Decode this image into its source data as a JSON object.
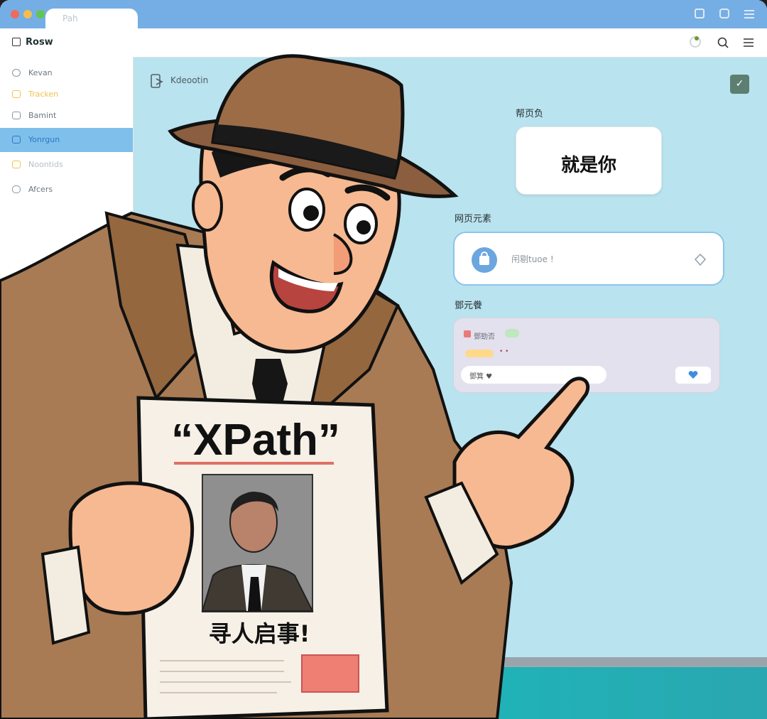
{
  "window": {
    "tab_label": "Pah",
    "title": "Rosw"
  },
  "sidebar": {
    "items": [
      {
        "label": "Kevan",
        "icon": "circle-icon"
      },
      {
        "label": "Tracken",
        "icon": "folder-icon"
      },
      {
        "label": "Bamint",
        "icon": "box-icon"
      },
      {
        "label": "Yonrgun",
        "icon": "tag-icon",
        "active": true
      },
      {
        "label": "Noontids",
        "icon": "note-icon"
      },
      {
        "label": "Afcers",
        "icon": "stack-icon"
      }
    ]
  },
  "main": {
    "logo": "Kdeootin",
    "section_page_label": "帮页负",
    "big_card_text": "就是你",
    "section_element_label": "网页元素",
    "element_input_text": "闬剔tuoe !",
    "section_list_label": "鄧元餋",
    "list_tag": "鄧勁否",
    "list_input_text": "鄧箕 ♥"
  },
  "poster": {
    "headline": "“XPath”",
    "caption": "寻人启事!"
  },
  "colors": {
    "titlebar": "#75aee4",
    "content_bg": "#b9e3ee",
    "accent_blue": "#6ba6df",
    "coat": "#a87b55",
    "hat": "#8a5e3e"
  }
}
